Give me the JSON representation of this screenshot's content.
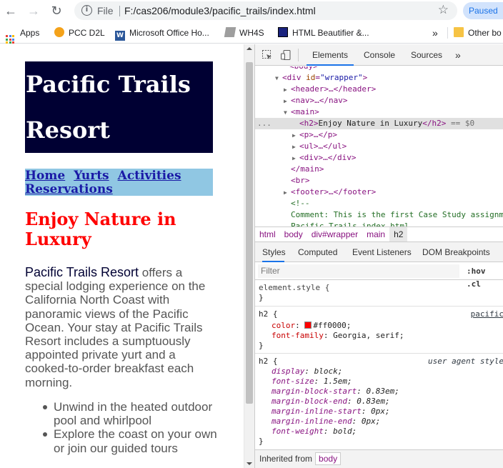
{
  "browser": {
    "url_scheme": "File",
    "url": "F:/cas206/module3/pacific_trails/index.html",
    "paused_label": "Paused"
  },
  "bookmarks": [
    {
      "label": "Apps",
      "icon": "apps-grid-icon"
    },
    {
      "label": "PCC D2L",
      "icon": "pcc-logo-icon"
    },
    {
      "label": "Microsoft Office Ho...",
      "icon": "word-icon"
    },
    {
      "label": "WH4S",
      "icon": "wh4s-icon"
    },
    {
      "label": "HTML Beautifier &...",
      "icon": "html-beautifier-icon"
    },
    {
      "label": "»",
      "icon": "chevron-double-right-icon"
    },
    {
      "label": "Other bo",
      "icon": "folder-icon"
    }
  ],
  "page": {
    "header_line1": "Pacific Trails",
    "header_line2": "Resort",
    "nav": [
      "Home",
      "Yurts",
      "Activities",
      "Reservations"
    ],
    "h2": "Enjoy Nature in Luxury",
    "intro_brand": "Pacific Trails Resort",
    "intro_text": " offers a special lodging experience on the California North Coast with panoramic views of the Pacific Ocean. Your stay at Pacific Trails Resort includes a sumptuously appointed private yurt and a cooked-to-order breakfast each morning.",
    "list": [
      "Unwind in the heated outdoor pool and whirlpool",
      "Explore the coast on your own or join our guided tours"
    ]
  },
  "devtools": {
    "tabs": [
      "Elements",
      "Console",
      "Sources",
      "»"
    ],
    "active_tab": "Elements",
    "dom": {
      "l0": "<body>",
      "l1_tag": "div",
      "l1_attr": "id",
      "l1_val": "\"wrapper\"",
      "l2": "<header>…</header>",
      "l3": "<nav>…</nav>",
      "l4": "<main>",
      "l5_tag_open": "<h2>",
      "l5_text": "Enjoy Nature in Luxury",
      "l5_tag_close": "</h2>",
      "l5_eq": " == $0",
      "l6": "<p>…</p>",
      "l7": "<ul>…</ul>",
      "l8": "<div>…</div>",
      "l9": "</main>",
      "l10": "<br>",
      "l11": "<footer>…</footer>",
      "l12": "<!--",
      "l13": "Comment: This is the first Case Study assignm",
      "l14": "Pacific Trails index.html",
      "dots": "..."
    },
    "breadcrumbs": [
      "html",
      "body",
      "div#wrapper",
      "main",
      "h2"
    ],
    "style_tabs": [
      "Styles",
      "Computed",
      "Event Listeners",
      "DOM Breakpoints"
    ],
    "filter_placeholder": "Filter",
    "hov": ":hov  .cl",
    "rules": {
      "element_style": "element.style {",
      "close": "}",
      "h2_selector": "h2 {",
      "h2_source": "pacific",
      "color_prop": "color",
      "color_val": "#ff0000;",
      "font_family_prop": "font-family",
      "font_family_val": "Georgia, serif;",
      "ua_selector": "h2 {",
      "ua_source": "user agent style",
      "ua_props": [
        {
          "p": "display",
          "v": "block;"
        },
        {
          "p": "font-size",
          "v": "1.5em;"
        },
        {
          "p": "margin-block-start",
          "v": "0.83em;"
        },
        {
          "p": "margin-block-end",
          "v": "0.83em;"
        },
        {
          "p": "margin-inline-start",
          "v": "0px;"
        },
        {
          "p": "margin-inline-end",
          "v": "0px;"
        },
        {
          "p": "font-weight",
          "v": "bold;"
        }
      ]
    },
    "inherited_label": "Inherited from",
    "inherited_tag": "body"
  },
  "colors": {
    "header_bg": "#000033",
    "nav_bg": "#90c7e3",
    "h2_color": "#ff0000"
  }
}
